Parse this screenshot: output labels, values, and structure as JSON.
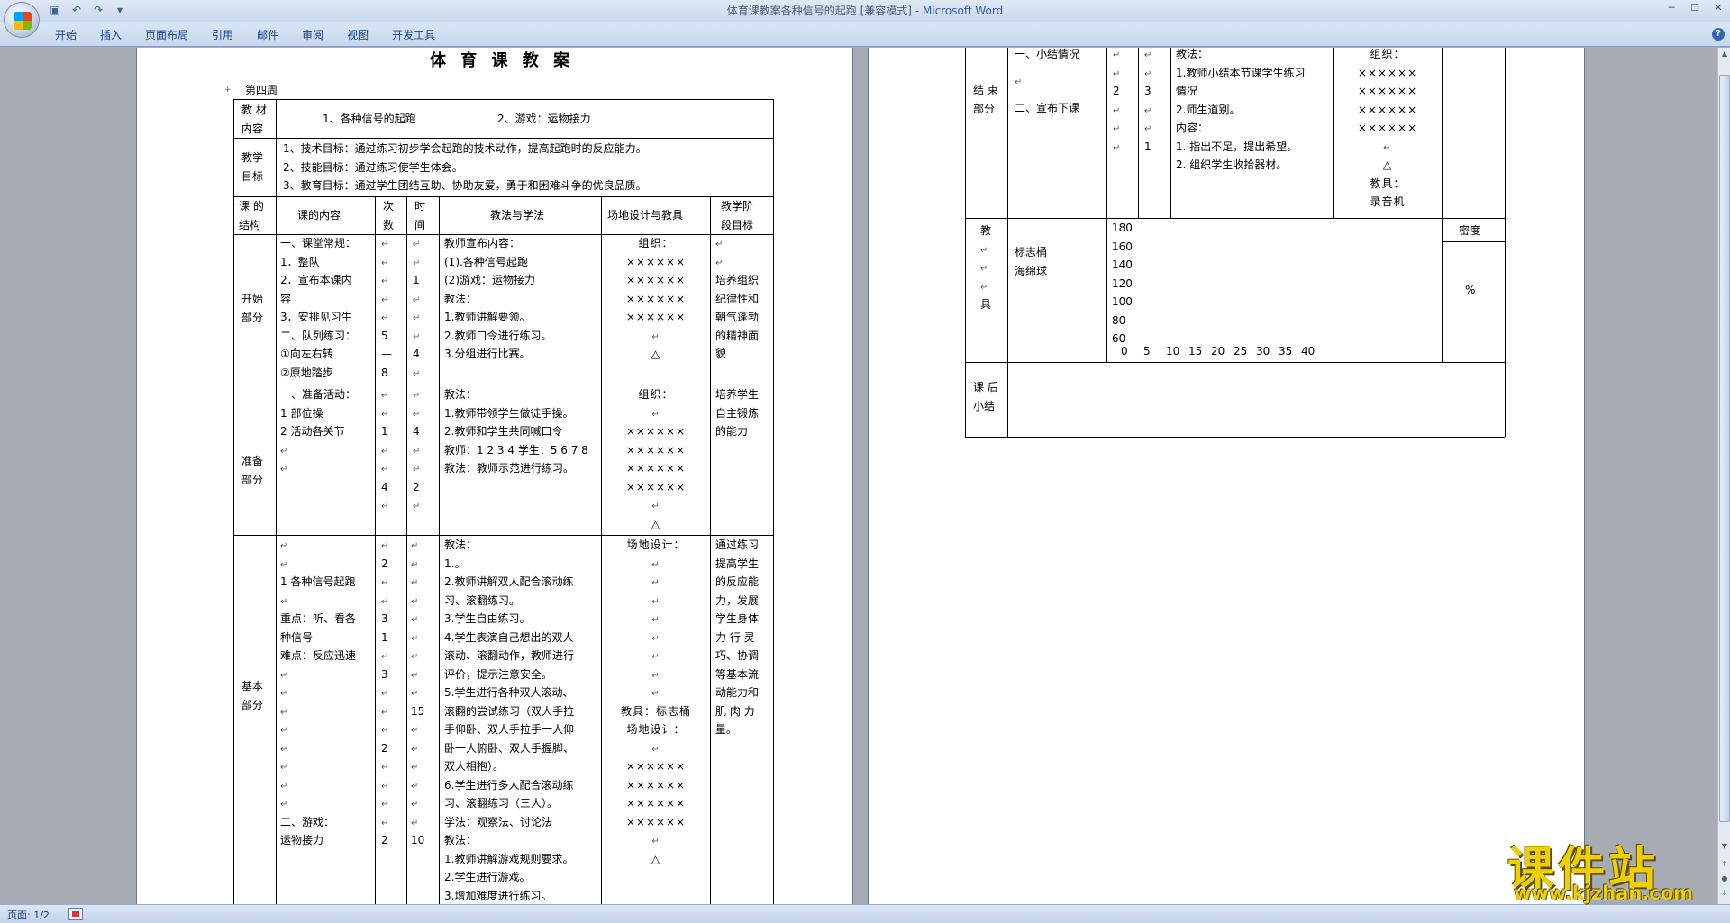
{
  "titlebar": {
    "doc_name": "体育课教案各种信号的起跑 [兼容模式]",
    "separator": " - ",
    "app_name": "Microsoft Word",
    "save_icon": "save-icon",
    "undo_icon": "undo-icon",
    "redo_icon": "redo-icon"
  },
  "ribbon": {
    "tabs": [
      "开始",
      "插入",
      "页面布局",
      "引用",
      "邮件",
      "审阅",
      "视图",
      "开发工具"
    ]
  },
  "statusbar": {
    "page_label": "页面: 1/2"
  },
  "watermark": {
    "cn": "课件站",
    "url": "www.kjzhan.com"
  },
  "page1": {
    "heading": "体 育 课 教 案",
    "week": "第四周",
    "content_label": [
      "教 材",
      "内容"
    ],
    "content_1": "1、各种信号的起跑",
    "content_2": "2、游戏：运物接力",
    "goal_label": [
      "教学",
      "目标"
    ],
    "goals": [
      "1、技术目标：通过练习初步学会起跑的技术动作，提高起跑时的反应能力。",
      "2、技能目标：通过练习使学生体会。",
      "3、教育目标：通过学生团结互助、协助友爱，勇于和困难斗争的优良品质。"
    ],
    "headers": {
      "structure": [
        "课 的",
        "结构"
      ],
      "content": "课的内容",
      "times": [
        "次",
        "数"
      ],
      "duration": [
        "时",
        "间"
      ],
      "method": "教法与学法",
      "venue": "场地设计与教具",
      "goal": [
        "教学阶",
        "段目标"
      ]
    },
    "start": {
      "label": [
        "开始",
        "部分"
      ],
      "content": [
        "一、课堂常规：",
        "1．整队",
        "2．宣布本课内",
        "容",
        "3．安排见习生",
        "二、队列练习：",
        "①向左右转",
        "②原地踏步"
      ],
      "times": [
        "",
        "",
        "",
        "",
        "",
        "5",
        "—",
        "8"
      ],
      "duration": [
        "",
        "",
        "1",
        "",
        "",
        "",
        "4",
        ""
      ],
      "method": [
        "教师宣布内容：",
        "(1).各种信号起跑",
        "(2)游戏：运物接力",
        "教法：",
        "1.教师讲解要领。",
        "2.教师口令进行练习。",
        "3.分组进行比赛。"
      ],
      "venue": [
        "组织：",
        "××××××",
        "××××××",
        "××××××",
        "××××××",
        "",
        "△"
      ],
      "goal": [
        "",
        "",
        "培养组织",
        "纪律性和",
        "朝气蓬勃",
        "的精神面",
        "貌"
      ]
    },
    "prep": {
      "label": [
        "准备",
        "部分"
      ],
      "content": [
        "一、准备活动：",
        "1 部位操",
        "2 活动各关节",
        "",
        ""
      ],
      "times": [
        "",
        "",
        "1",
        "",
        "",
        "4",
        ""
      ],
      "duration": [
        "",
        "",
        "4",
        "",
        "",
        "2",
        ""
      ],
      "method": [
        "教法：",
        "1.教师带领学生做徒手操。",
        "2.教师和学生共同喊口令",
        "教师：1 2 3 4  学生：5 6 7 8",
        "教法：教师示范进行练习。"
      ],
      "venue": [
        "组织：",
        "",
        "××××××",
        "××××××",
        "××××××",
        "××××××",
        "",
        "△"
      ],
      "goal": [
        "培养学生",
        "自主锻炼",
        "的能力"
      ]
    },
    "basic": {
      "label": [
        "基本",
        "部分"
      ],
      "content": [
        "",
        "",
        "1 各种信号起跑",
        "",
        "重点：听、看各",
        "种信号",
        "难点：反应迅速",
        "",
        "",
        "",
        "",
        "",
        "",
        "",
        "",
        "二、游戏：",
        "运物接力"
      ],
      "times": [
        "",
        "2",
        "",
        "",
        "3",
        "1",
        "",
        "3",
        "",
        "",
        "",
        "2",
        "",
        "",
        "",
        "",
        "2"
      ],
      "duration": [
        "",
        "",
        "",
        "",
        "",
        "",
        "",
        "",
        "",
        "15",
        "",
        "",
        "",
        "",
        "",
        "",
        "10"
      ],
      "method": [
        "教法：",
        "1.。",
        "2.教师讲解双人配合滚动练",
        "习、滚翻练习。",
        "3.学生自由练习。",
        "4.学生表演自己想出的双人",
        "滚动、滚翻动作，教师进行",
        "评价，提示注意安全。",
        "5.学生进行各种双人滚动、",
        "滚翻的尝试练习（双人手拉",
        "手仰卧、双人手拉手一人仰",
        "卧一人俯卧、双人手握脚、",
        "双人相抱）。",
        "6.学生进行多人配合滚动练",
        "习、滚翻练习（三人）。",
        "学法：观察法、讨论法",
        "教法：",
        "1.教师讲解游戏规则要求。",
        "2.学生进行游戏。",
        "3.增加难度进行练习。"
      ],
      "venue": [
        "场地设计：",
        "",
        "",
        "",
        "",
        "",
        "",
        "",
        "",
        "教具：标志桶",
        "场地设计：",
        "",
        "××××××",
        "××××××",
        "××××××",
        "××××××",
        "",
        "△"
      ],
      "goal": [
        "通过练习",
        "提高学生",
        "的反应能",
        "力，发展",
        "学生身体",
        "力 行 灵",
        "巧、协调",
        "等基本流",
        "动能力和",
        "肌 肉 力",
        "量。"
      ]
    }
  },
  "page2": {
    "end": {
      "label": [
        "结 束",
        "部分"
      ],
      "content": [
        "一、小结情况",
        "",
        "二、宣布下课"
      ],
      "times": [
        "",
        "",
        "2",
        "",
        "",
        ""
      ],
      "duration": [
        "",
        "",
        "3",
        "",
        "",
        "1"
      ],
      "method": [
        "教法：",
        "1.教师小结本节课学生练习",
        "情况",
        "2.师生道别。",
        "内容：",
        "1.    指出不足，提出希望。",
        "2.    组织学生收拾器材。"
      ],
      "venue": [
        "组织：",
        "××××××",
        "××××××",
        "××××××",
        "××××××",
        "",
        "△",
        "教具：",
        "录音机"
      ]
    },
    "equipment": {
      "label": [
        "教",
        "",
        "",
        "",
        "具"
      ],
      "items": [
        "标志桶",
        "海绵球"
      ],
      "y_ticks": [
        "180",
        "160",
        "140",
        "120",
        "100",
        "80",
        "60"
      ],
      "x_ticks": [
        "0",
        "5",
        "10",
        "15",
        "20",
        "25",
        "30",
        "35",
        "40"
      ],
      "density_label": "密度",
      "density_unit": "%"
    },
    "summary": {
      "label": [
        "课 后",
        "小结"
      ]
    }
  }
}
